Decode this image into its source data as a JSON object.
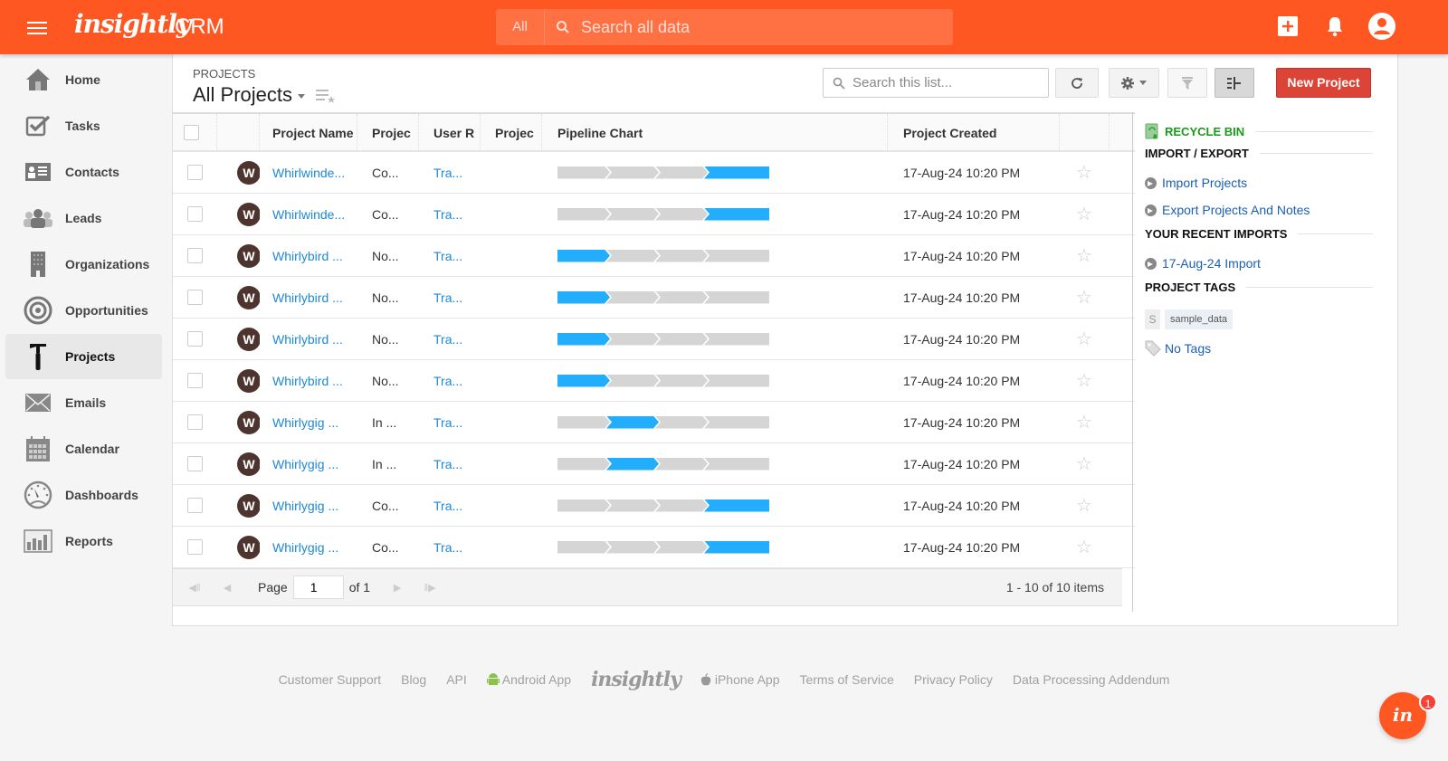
{
  "topbar": {
    "brand": "insightly",
    "product": "CRM",
    "search_scope": "All",
    "search_placeholder": "Search all data"
  },
  "sidebar": {
    "items": [
      {
        "label": "Home",
        "icon": "home-icon"
      },
      {
        "label": "Tasks",
        "icon": "tasks-icon"
      },
      {
        "label": "Contacts",
        "icon": "contacts-icon"
      },
      {
        "label": "Leads",
        "icon": "leads-icon"
      },
      {
        "label": "Organizations",
        "icon": "organizations-icon"
      },
      {
        "label": "Opportunities",
        "icon": "opportunities-icon"
      },
      {
        "label": "Projects",
        "icon": "projects-icon",
        "active": true
      },
      {
        "label": "Emails",
        "icon": "emails-icon"
      },
      {
        "label": "Calendar",
        "icon": "calendar-icon"
      },
      {
        "label": "Dashboards",
        "icon": "dashboards-icon"
      },
      {
        "label": "Reports",
        "icon": "reports-icon"
      }
    ]
  },
  "header": {
    "section": "PROJECTS",
    "view": "All Projects",
    "list_search_placeholder": "Search this list...",
    "new_button": "New Project"
  },
  "table": {
    "columns": [
      "",
      "",
      "Project Name",
      "Projec",
      "User R",
      "Projec",
      "Pipeline Chart",
      "Project Created",
      ""
    ],
    "pipeline_stages": 4,
    "rows": [
      {
        "avatar": "W",
        "name": "Whirlwinde...",
        "status": "Co...",
        "user": "Tra...",
        "stage": 4,
        "created": "17-Aug-24 10:20 PM"
      },
      {
        "avatar": "W",
        "name": "Whirlwinde...",
        "status": "Co...",
        "user": "Tra...",
        "stage": 4,
        "created": "17-Aug-24 10:20 PM"
      },
      {
        "avatar": "W",
        "name": "Whirlybird ...",
        "status": "No...",
        "user": "Tra...",
        "stage": 1,
        "created": "17-Aug-24 10:20 PM"
      },
      {
        "avatar": "W",
        "name": "Whirlybird ...",
        "status": "No...",
        "user": "Tra...",
        "stage": 1,
        "created": "17-Aug-24 10:20 PM"
      },
      {
        "avatar": "W",
        "name": "Whirlybird ...",
        "status": "No...",
        "user": "Tra...",
        "stage": 1,
        "created": "17-Aug-24 10:20 PM"
      },
      {
        "avatar": "W",
        "name": "Whirlybird ...",
        "status": "No...",
        "user": "Tra...",
        "stage": 1,
        "created": "17-Aug-24 10:20 PM"
      },
      {
        "avatar": "W",
        "name": "Whirlygig ...",
        "status": "In ...",
        "user": "Tra...",
        "stage": 2,
        "created": "17-Aug-24 10:20 PM"
      },
      {
        "avatar": "W",
        "name": "Whirlygig ...",
        "status": "In ...",
        "user": "Tra...",
        "stage": 2,
        "created": "17-Aug-24 10:20 PM"
      },
      {
        "avatar": "W",
        "name": "Whirlygig ...",
        "status": "Co...",
        "user": "Tra...",
        "stage": 4,
        "created": "17-Aug-24 10:20 PM"
      },
      {
        "avatar": "W",
        "name": "Whirlygig ...",
        "status": "Co...",
        "user": "Tra...",
        "stage": 4,
        "created": "17-Aug-24 10:20 PM"
      }
    ]
  },
  "pager": {
    "page_label": "Page",
    "page": "1",
    "of_label": "of 1",
    "items_label": "1 - 10 of 10 items"
  },
  "right_panel": {
    "recycle_bin": "RECYCLE BIN",
    "import_export": "IMPORT / EXPORT",
    "import_link": "Import Projects",
    "export_link": "Export Projects And Notes",
    "recent_imports": "YOUR RECENT IMPORTS",
    "recent_import_link": "17-Aug-24 Import",
    "project_tags": "PROJECT TAGS",
    "tag_letter": "S",
    "tag": "sample_data",
    "no_tags": "No Tags"
  },
  "footer": {
    "links": [
      "Customer Support",
      "Blog",
      "API",
      "Android App",
      "iPhone App",
      "Terms of Service",
      "Privacy Policy",
      "Data Processing Addendum"
    ],
    "logo": "insightly"
  },
  "chat": {
    "label": "in",
    "badge": "1"
  },
  "colors": {
    "brand": "#ff5722",
    "accent_blue": "#22aefc",
    "new_button": "#db4437",
    "recycle_green": "#1a9a1a",
    "link": "#1e88d8"
  }
}
